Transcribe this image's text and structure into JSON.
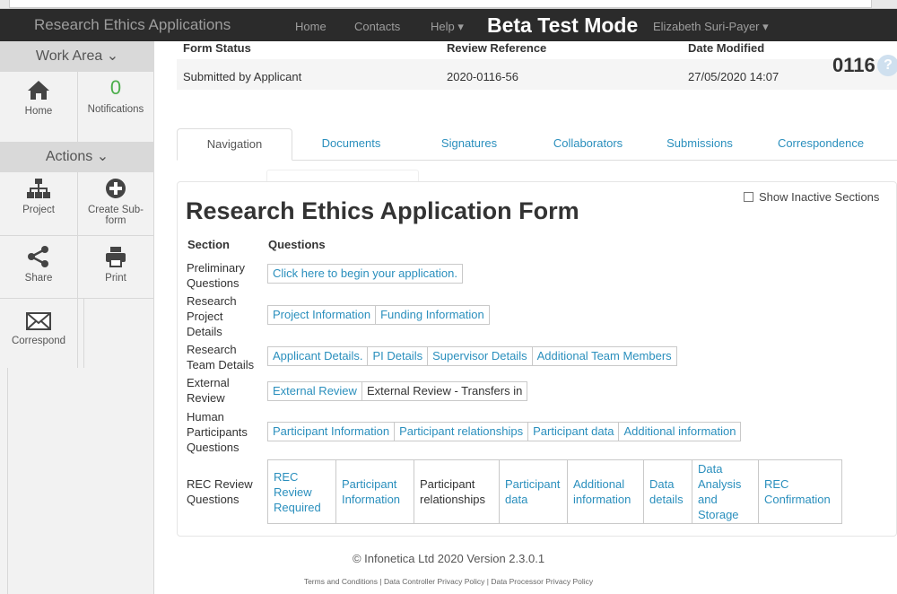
{
  "navbar": {
    "brand": "Research Ethics Applications",
    "links": [
      "Home",
      "Contacts",
      "Help ▾"
    ],
    "beta_label": "Beta Test Mode",
    "user": "Elizabeth Suri-Payer ▾"
  },
  "sidebar": {
    "work_area_label": "Work Area ⌄",
    "notifications_count": "0",
    "home_label": "Home",
    "notifications_label": "Notifications",
    "actions_label": "Actions ⌄",
    "project_label": "Project",
    "create_subform_label": "Create Sub-form",
    "share_label": "Share",
    "print_label": "Print",
    "correspond_label": "Correspond"
  },
  "status": {
    "form_status_header": "Form Status",
    "review_reference_header": "Review Reference",
    "date_modified_header": "Date Modified",
    "form_status": "Submitted by Applicant",
    "review_reference": "2020-0116-56",
    "date_modified": "27/05/2020 14:07",
    "short_id": "0116",
    "help_glyph": "?"
  },
  "tabs": [
    "Navigation",
    "Documents",
    "Signatures",
    "Collaborators",
    "Submissions",
    "Correspondence"
  ],
  "form": {
    "title": "Research Ethics Application Form",
    "show_inactive_label": "Show Inactive Sections",
    "section_header": "Section",
    "questions_header": "Questions",
    "sections": [
      {
        "name": "Preliminary Questions",
        "questions": [
          "Click here to begin your application."
        ]
      },
      {
        "name": "Research Project Details",
        "questions": [
          "Project Information",
          "Funding Information"
        ]
      },
      {
        "name": "Research Team Details",
        "questions": [
          "Applicant Details.",
          "PI Details",
          "Supervisor Details",
          "Additional Team Members"
        ]
      },
      {
        "name": "External Review",
        "questions": [
          "External Review",
          "External Review - Transfers in"
        ]
      },
      {
        "name": "Human Participants Questions",
        "questions": [
          "Participant Information",
          "Participant relationships",
          "Participant data",
          "Additional information"
        ]
      },
      {
        "name": "REC Review Questions",
        "questions": [
          "REC Review Required",
          "Participant Information",
          "Participant relationships",
          "Participant data",
          "Additional information",
          "Data details",
          "Data Analysis and Storage",
          "REC Confirmation"
        ]
      }
    ]
  },
  "footer": {
    "copyright": "© Infonetica Ltd 2020 Version 2.3.0.1",
    "links": "Terms and Conditions | Data Controller Privacy Policy | Data Processor Privacy Policy"
  },
  "colors": {
    "navbar_bg": "#2b2b2b",
    "link_blue": "#2a8fbd",
    "sidebar_bg": "#f2f2f2"
  }
}
